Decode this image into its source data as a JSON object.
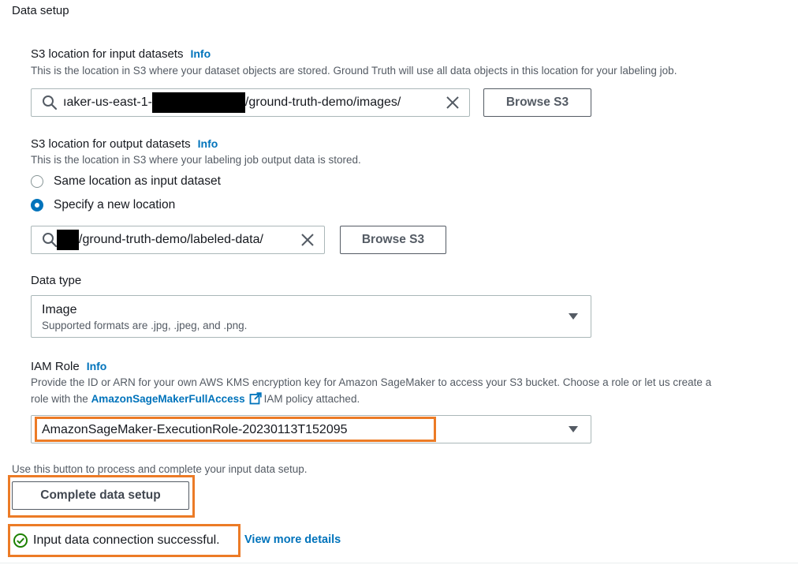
{
  "section": {
    "title": "Data setup"
  },
  "input_dataset": {
    "label": "S3 location for input datasets",
    "info": "Info",
    "description": "This is the location in S3 where your dataset objects are stored. Ground Truth will use all data objects in this location for your labeling job.",
    "value_prefix": "ıaker-us-east-1-",
    "value_suffix": "/ground-truth-demo/images/",
    "browse_label": "Browse S3"
  },
  "output_dataset": {
    "label": "S3 location for output datasets",
    "info": "Info",
    "description": "This is the location in S3 where your labeling job output data is stored.",
    "options": [
      "Same location as input dataset",
      "Specify a new location"
    ],
    "selected": "Specify a new location",
    "value_suffix": "/ground-truth-demo/labeled-data/",
    "browse_label": "Browse S3"
  },
  "data_type": {
    "label": "Data type",
    "value": "Image",
    "hint": "Supported formats are .jpg, .jpeg, and .png."
  },
  "iam_role": {
    "label": "IAM Role",
    "info": "Info",
    "description_part1": "Provide the ID or ARN for your own AWS KMS encryption key for Amazon SageMaker to access your S3 bucket. Choose a role or let us create a",
    "description_part2": "role with the",
    "policy_link": "AmazonSageMakerFullAccess",
    "description_part3": "IAM policy attached.",
    "value": "AmazonSageMaker-ExecutionRole-20230113T152095"
  },
  "complete": {
    "hint": "Use this button to process and complete your input data setup.",
    "button_label": "Complete data setup"
  },
  "status": {
    "message": "Input data connection successful.",
    "link": "View more details"
  },
  "colors": {
    "link": "#0073bb",
    "highlight": "#ec7b26",
    "success": "#1d8102"
  },
  "icons": [
    "search-icon",
    "clear-icon",
    "caret-down-icon",
    "external-link-icon",
    "check-circle-icon"
  ]
}
